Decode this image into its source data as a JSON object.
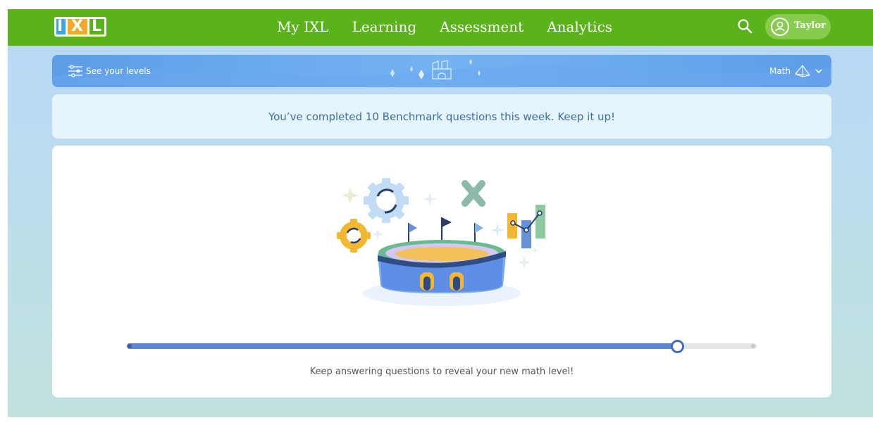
{
  "app": {
    "logo_text": "IXL",
    "brand_color": "#5ab31b",
    "accent_color": "#5b86d3"
  },
  "nav": {
    "items": [
      {
        "label": "My IXL"
      },
      {
        "label": "Learning"
      },
      {
        "label": "Assessment"
      },
      {
        "label": "Analytics"
      }
    ]
  },
  "header": {
    "search_icon": "search-icon",
    "user_name": "Taylor",
    "avatar_icon": "user-icon"
  },
  "levels_bar": {
    "link_label": "See your levels",
    "link_icon": "sliders-icon",
    "subject": "Math",
    "subject_icon": "pyramid-icon"
  },
  "notice": {
    "text": "You’ve completed 10 Benchmark questions this week. Keep it up!"
  },
  "progress": {
    "value": 0.874,
    "caption": "Keep answering questions to reveal your new math level!"
  }
}
